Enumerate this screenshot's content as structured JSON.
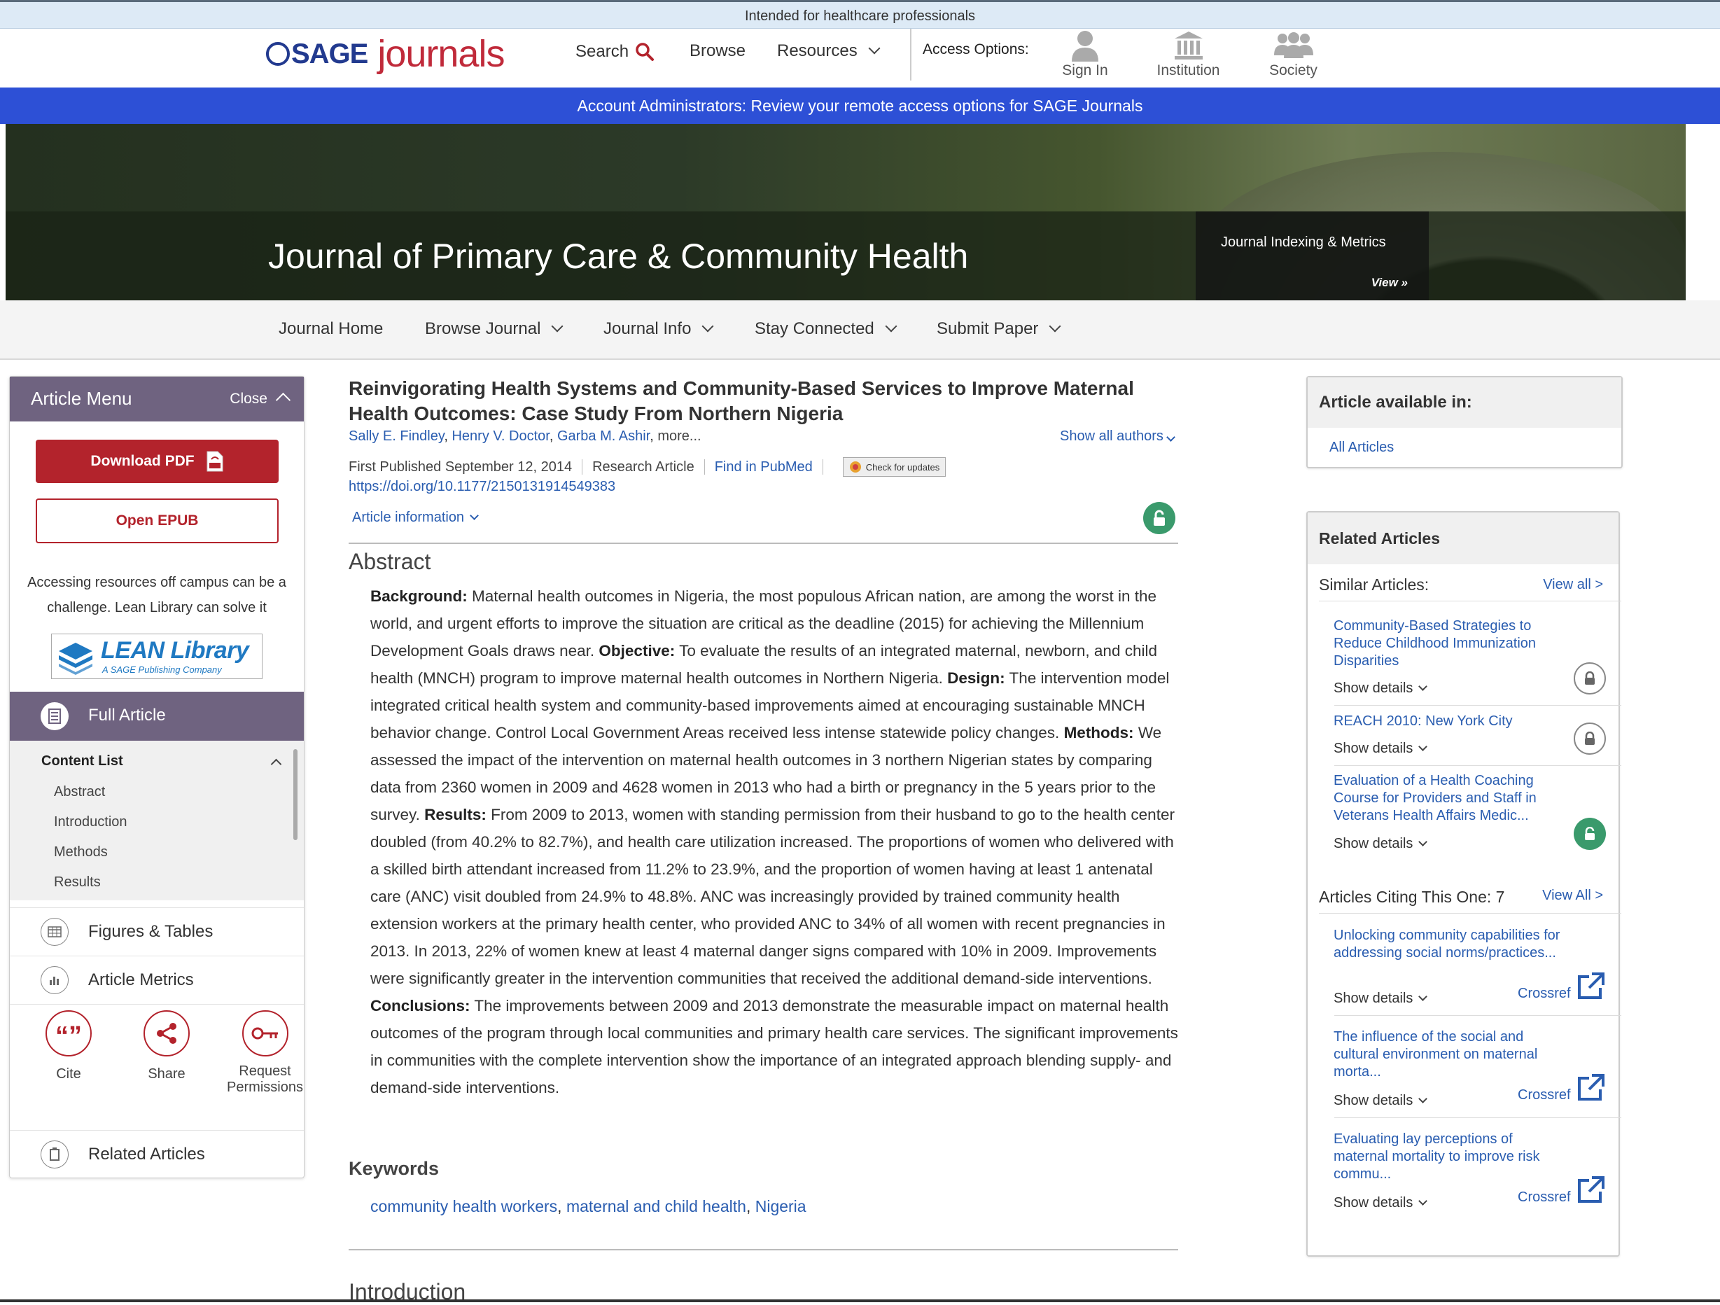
{
  "top_notice": "Intended for healthcare professionals",
  "header": {
    "logo_sage": "SAGE",
    "logo_journals": "journals",
    "search": "Search",
    "browse": "Browse",
    "resources": "Resources",
    "access_options": "Access Options:",
    "sign_in": "Sign In",
    "institution": "Institution",
    "society": "Society"
  },
  "admin_banner": "Account Administrators: Review your remote access options for SAGE Journals",
  "hero": {
    "journal_title": "Journal of Primary Care & Community Health",
    "metrics_title": "Journal Indexing & Metrics",
    "metrics_view": "View »"
  },
  "subnav": {
    "home": "Journal Home",
    "browse": "Browse Journal",
    "info": "Journal Info",
    "connected": "Stay Connected",
    "submit": "Submit Paper"
  },
  "sidebar": {
    "title": "Article Menu",
    "close": "Close",
    "download_pdf": "Download PDF",
    "open_epub": "Open EPUB",
    "lean_text": "Accessing resources off campus can be a challenge. Lean Library can solve it",
    "lean_logo_main": "LEAN Library",
    "lean_logo_sub": "A SAGE Publishing Company",
    "full_article": "Full Article",
    "content_list": "Content List",
    "content_items": [
      "Abstract",
      "Introduction",
      "Methods",
      "Results"
    ],
    "figures": "Figures & Tables",
    "metrics": "Article Metrics",
    "cite": "Cite",
    "share": "Share",
    "request": "Request Permissions",
    "related": "Related Articles"
  },
  "article": {
    "title": "Reinvigorating Health Systems and Community-Based Services to Improve Maternal Health Outcomes: Case Study From Northern Nigeria",
    "author1": "Sally E. Findley",
    "author2": "Henry V. Doctor",
    "author3": "Garba M. Ashir",
    "more": "more...",
    "show_all_authors": "Show all authors",
    "first_published": "First Published September 12, 2014",
    "type": "Research Article",
    "pubmed": "Find in PubMed",
    "check_updates": "Check for updates",
    "doi": "https://doi.org/10.1177/2150131914549383",
    "article_info": "Article information",
    "abstract_heading": "Abstract",
    "abstract": [
      {
        "label": "Background:",
        "text": " Maternal health outcomes in Nigeria, the most populous African nation, are among the worst in the world, and urgent efforts to improve the situation are critical as the deadline (2015) for achieving the Millennium Development Goals draws near. "
      },
      {
        "label": "Objective:",
        "text": " To evaluate the results of an integrated maternal, newborn, and child health (MNCH) program to improve maternal health outcomes in Northern Nigeria. "
      },
      {
        "label": "Design:",
        "text": " The intervention model integrated critical health system and community-based improvements aimed at encouraging sustainable MNCH behavior change. Control Local Government Areas received less intense statewide policy changes. "
      },
      {
        "label": "Methods:",
        "text": " We assessed the impact of the intervention on maternal health outcomes in 3 northern Nigerian states by comparing data from 2360 women in 2009 and 4628 women in 2013 who had a birth or pregnancy in the 5 years prior to the survey. "
      },
      {
        "label": "Results:",
        "text": " From 2009 to 2013, women with standing permission from their husband to go to the health center doubled (from 40.2% to 82.7%), and health care utilization increased. The proportions of women who delivered with a skilled birth attendant increased from 11.2% to 23.9%, and the proportion of women having at least 1 antenatal care (ANC) visit doubled from 24.9% to 48.8%. ANC was increasingly provided by trained community health extension workers at the primary health center, who provided ANC to 34% of all women with recent pregnancies in 2013. In 2013, 22% of women knew at least 4 maternal danger signs compared with 10% in 2009. Improvements were significantly greater in the intervention communities that received the additional demand-side interventions. "
      },
      {
        "label": "Conclusions:",
        "text": " The improvements between 2009 and 2013 demonstrate the measurable impact on maternal health outcomes of the program through local communities and primary health care services. The significant improvements in communities with the complete intervention show the importance of an integrated approach blending supply- and demand-side interventions."
      }
    ],
    "keywords_heading": "Keywords",
    "keywords": [
      "community health workers",
      "maternal and child health",
      "Nigeria"
    ],
    "intro_heading": "Introduction"
  },
  "right": {
    "available_title": "Article available in:",
    "all_articles": "All Articles",
    "related_title": "Related Articles",
    "similar_label": "Similar Articles:",
    "view_all": "View all >",
    "similar": [
      {
        "title": "Community-Based Strategies to Reduce Childhood Immunization Disparities",
        "lock": "grey"
      },
      {
        "title": "REACH 2010: New York City",
        "lock": "grey"
      },
      {
        "title": "Evaluation of a Health Coaching Course for Providers and Staff in Veterans Health Affairs Medic...",
        "lock": "green"
      }
    ],
    "citing_label": "Articles Citing This One: 7",
    "citing_view_all": "View All >",
    "citing": [
      {
        "title": "Unlocking community capabilities for addressing social norms/practices..."
      },
      {
        "title": "The influence of the social and cultural environment on maternal morta..."
      },
      {
        "title": "Evaluating lay perceptions of maternal mortality to improve risk commu..."
      }
    ],
    "show_details": "Show details",
    "crossref": "Crossref"
  },
  "colors": {
    "brand_red": "#b3232c",
    "menu_purple": "#6f6380",
    "banner_blue": "#2d50d6",
    "link": "#2a5db0"
  }
}
